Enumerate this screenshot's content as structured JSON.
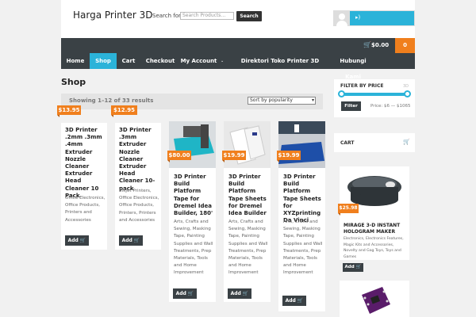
{
  "site": {
    "title": "Harga Printer 3D"
  },
  "search": {
    "label": "Search for:",
    "placeholder": "Search Products…",
    "button": "Search"
  },
  "cart_bar": {
    "total": "$0.00",
    "count": "0"
  },
  "nav": [
    "Home",
    "Shop",
    "Cart",
    "Checkout",
    "My Account",
    "Direktori Toko Printer 3D",
    "Hubungi Kami"
  ],
  "page": {
    "title": "Shop",
    "showing": "Showing 1–12 of 33 results",
    "sort": "Sort by popularity"
  },
  "products": [
    {
      "price": "$13.95",
      "title": "3D Printer .2mm .3mm .4mm Extruder Nozzle Cleaner Extruder Head Cleaner 10 Pack",
      "cats": "Office Electronics, Office Products, Printers and Accessories",
      "add": "Add"
    },
    {
      "price": "$12.95",
      "title": "3D Printer .3mm Extruder Nozzle Cleaner Extruder Head Cleaner 10-pack",
      "cats": "Inkjet Printers, Office Electronics, Office Products, Printers, Printers and Accessories",
      "add": "Add"
    },
    {
      "price": "$80.00",
      "title": "3D Printer Build Platform Tape for Dremel Idea Builder, 180'",
      "cats": "Arts, Crafts and Sewing, Masking Tape, Painting Supplies and Wall Treatments, Prep Materials, Tools and Home Improvement",
      "add": "Add"
    },
    {
      "price": "$19.99",
      "title": "3D Printer Build Platform Tape Sheets for Dremel Idea Builder",
      "cats": "Arts, Crafts and Sewing, Masking Tape, Painting Supplies and Wall Treatments, Prep Materials, Tools and Home Improvement",
      "add": "Add"
    },
    {
      "price": "$19.99",
      "title": "3D Printer Build Platform Tape Sheets for XYZprinting Da Vinci",
      "cats": "Arts, Crafts and Sewing, Masking Tape, Painting Supplies and Wall Treatments, Prep Materials, Tools and Home Improvement",
      "add": "Add"
    }
  ],
  "sidebar": {
    "filter_title": "FILTER BY PRICE",
    "filter_button": "Filter",
    "price_range": "Price: $6 — $1065",
    "cart_title": "CART",
    "featured": {
      "price": "$25.98",
      "title": "MIRAGE 3-D INSTANT HOLOGRAM MAKER",
      "cats": "Electronics, Electronics Features, Magic Kits and Accessories, Novelty and Gag Toys, Toys and Games",
      "add": "Add"
    }
  },
  "icons": {
    "cart": "cart-icon",
    "user": "user-avatar-icon",
    "speaker": "speaker-icon"
  },
  "colors": {
    "accent": "#2bb3d9",
    "price": "#f07f1d",
    "dark": "#3a4145"
  }
}
